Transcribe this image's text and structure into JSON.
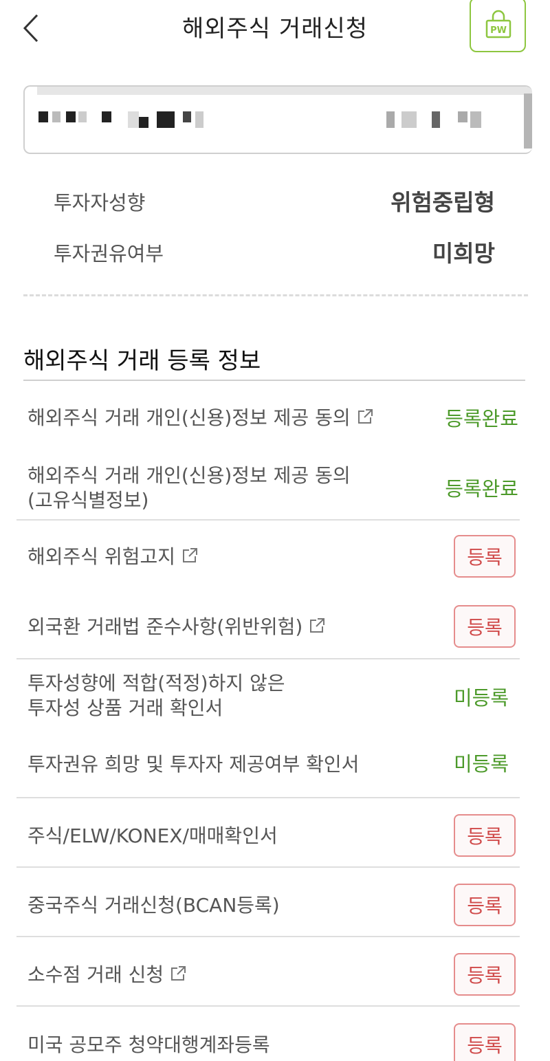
{
  "header": {
    "title": "해외주식 거래신청",
    "pw_label": "PW"
  },
  "profile": {
    "invest_type_label": "투자자성향",
    "invest_type_value": "위험중립형",
    "solicit_label": "투자권유여부",
    "solicit_value": "미희망"
  },
  "section": {
    "title": "해외주식 거래 등록 정보"
  },
  "colors": {
    "accent_green": "#4c9a2a",
    "pw_border": "#8dc63f",
    "register_red": "#d04a4a"
  },
  "items": [
    {
      "label": "해외주식 거래 개인(신용)정보 제공 동의",
      "label2": "",
      "status": "등록완료",
      "type": "done",
      "external": true
    },
    {
      "label": "해외주식 거래 개인(신용)정보 제공 동의",
      "label2": "(고유식별정보)",
      "status": "등록완료",
      "type": "done",
      "external": false
    },
    {
      "label": "해외주식 위험고지",
      "label2": "",
      "status": "등록",
      "type": "button",
      "external": true
    },
    {
      "label": "외국환 거래법 준수사항(위반위험)",
      "label2": "",
      "status": "등록",
      "type": "button",
      "external": true
    },
    {
      "label": "투자성향에 적합(적정)하지 않은",
      "label2": "투자성 상품 거래 확인서",
      "status": "미등록",
      "type": "none",
      "external": false
    },
    {
      "label": "투자권유 희망 및 투자자 제공여부 확인서",
      "label2": "",
      "status": "미등록",
      "type": "none",
      "external": false
    },
    {
      "label": "주식/ELW/KONEX/매매확인서",
      "label2": "",
      "status": "등록",
      "type": "button",
      "external": false
    },
    {
      "label": "중국주식 거래신청(BCAN등록)",
      "label2": "",
      "status": "등록",
      "type": "button",
      "external": false
    },
    {
      "label": "소수점 거래 신청",
      "label2": "",
      "status": "등록",
      "type": "button",
      "external": true
    },
    {
      "label": "미국 공모주 청약대행계좌등록",
      "label2": "",
      "status": "등록",
      "type": "button",
      "external": false
    }
  ]
}
